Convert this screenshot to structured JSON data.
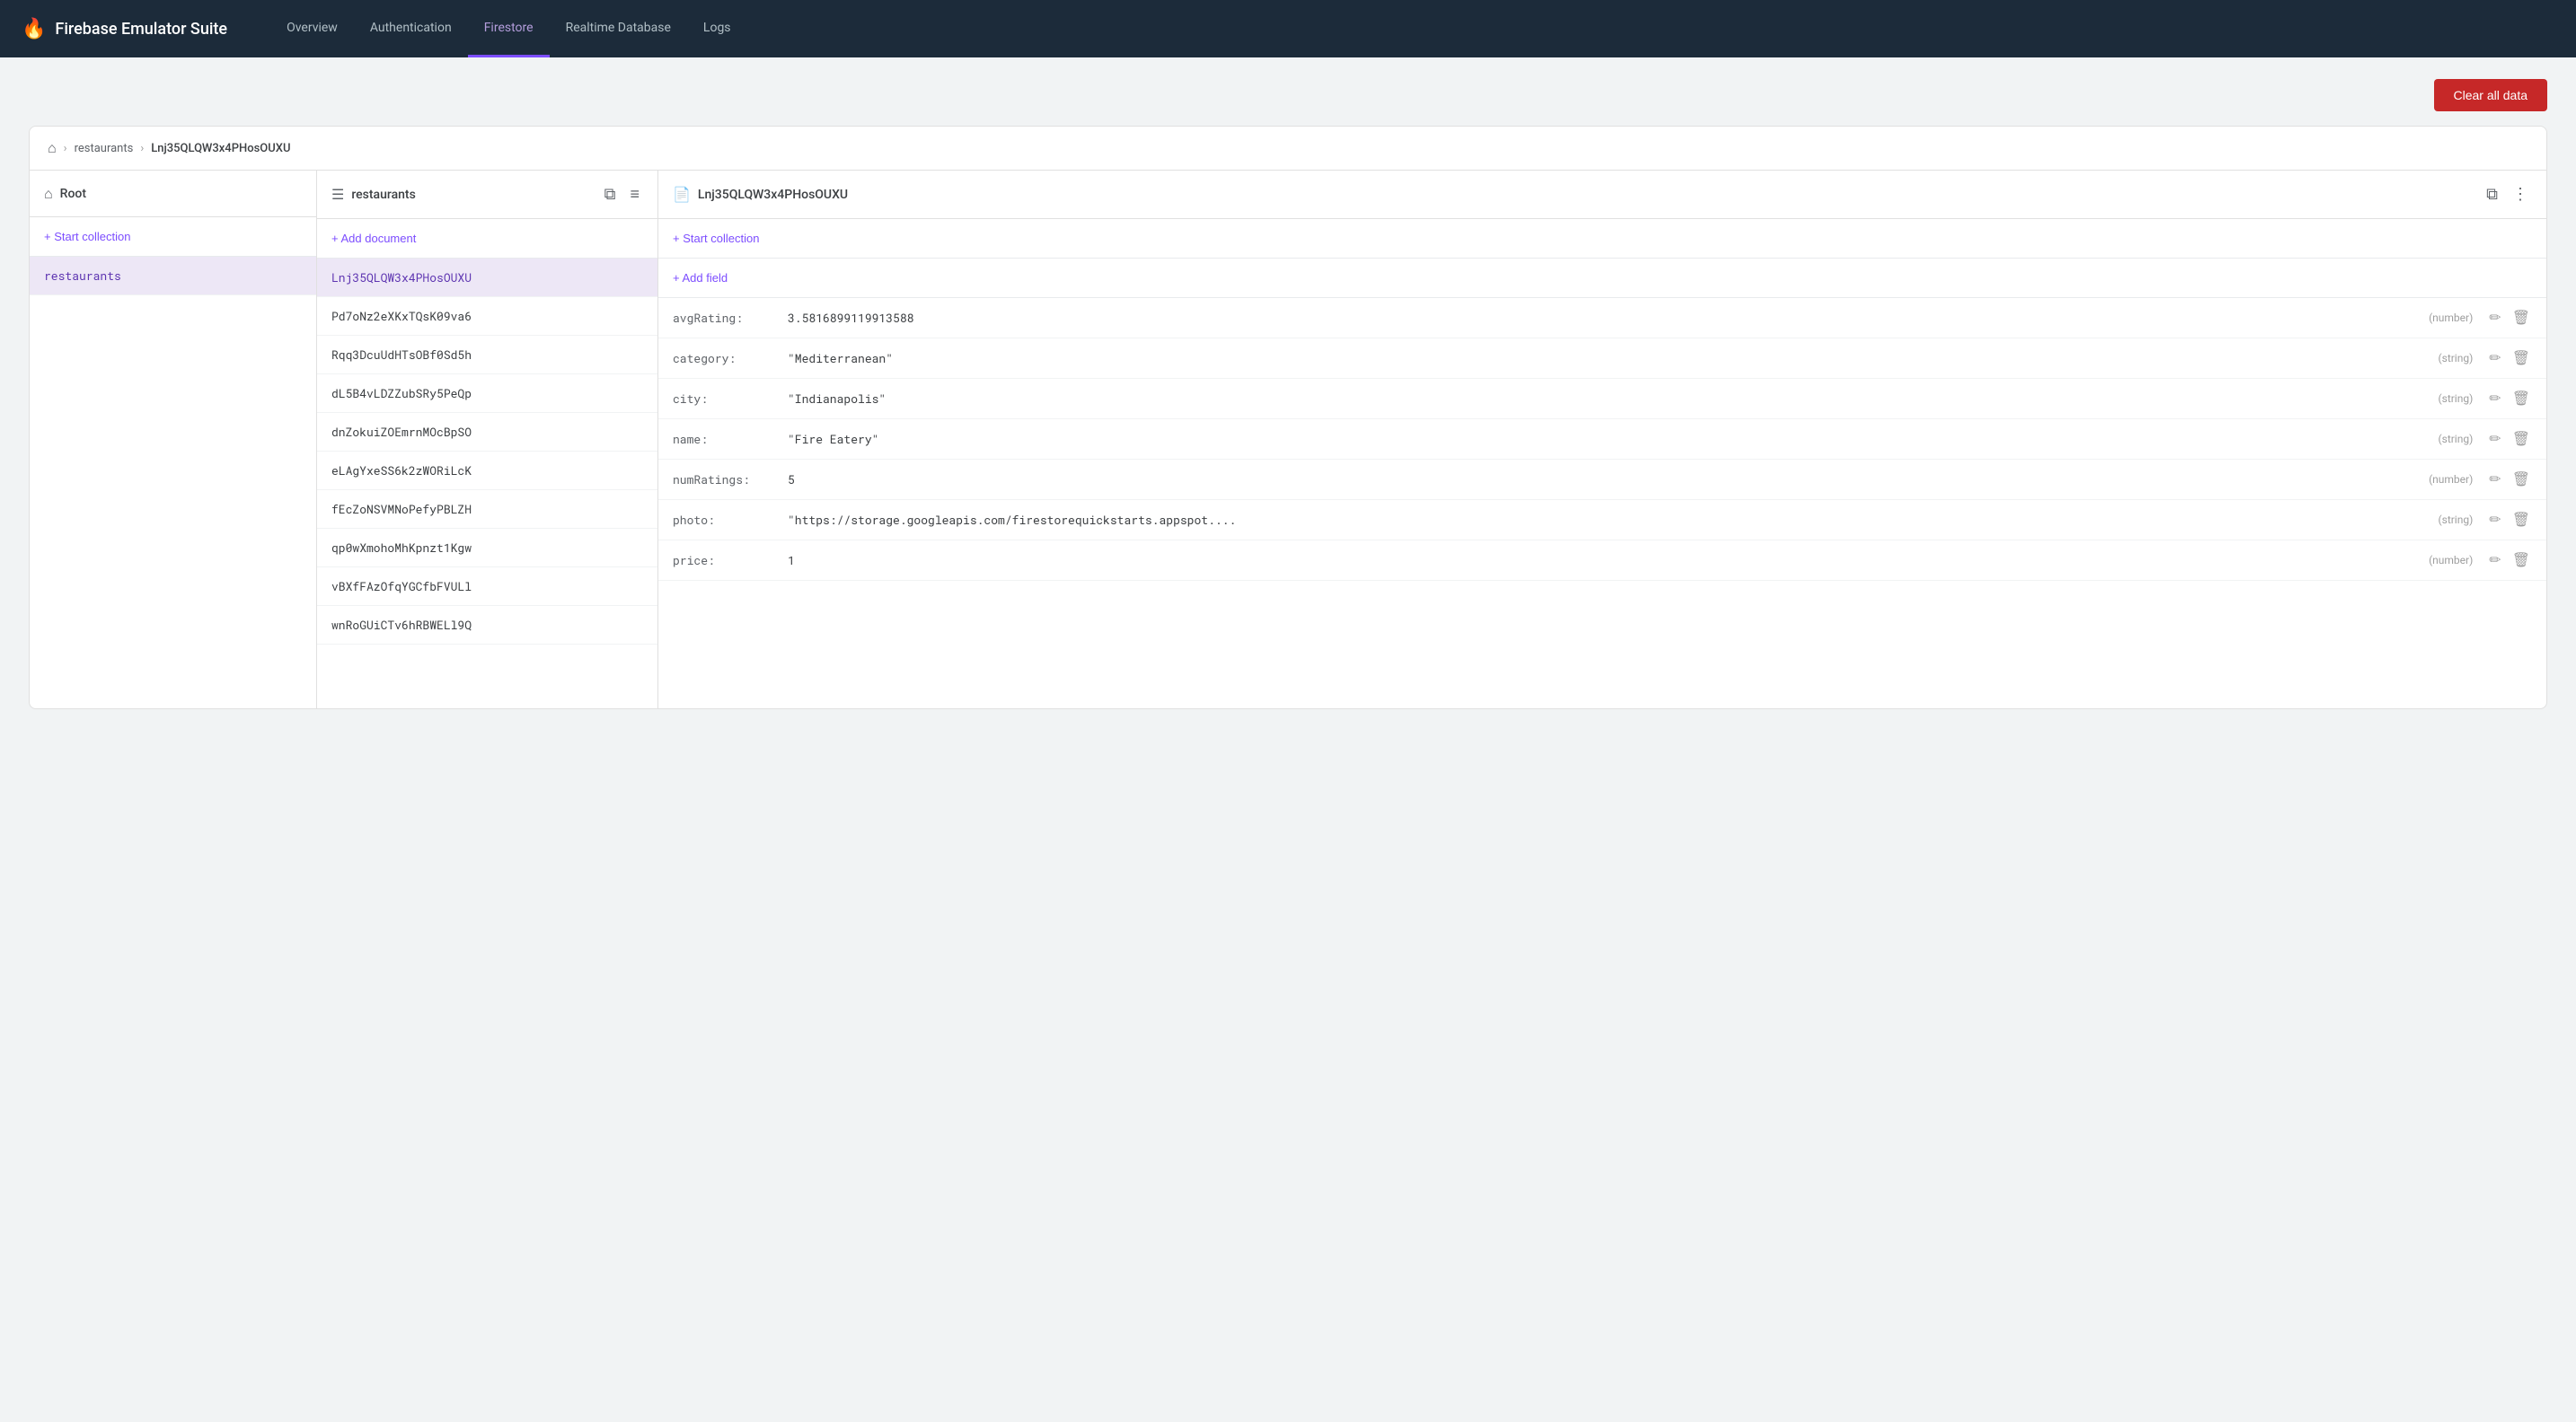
{
  "app": {
    "title": "Firebase Emulator Suite",
    "flame_icon": "🔥"
  },
  "nav": {
    "tabs": [
      {
        "id": "overview",
        "label": "Overview",
        "active": false
      },
      {
        "id": "authentication",
        "label": "Authentication",
        "active": false
      },
      {
        "id": "firestore",
        "label": "Firestore",
        "active": true
      },
      {
        "id": "realtime-database",
        "label": "Realtime Database",
        "active": false
      },
      {
        "id": "logs",
        "label": "Logs",
        "active": false
      }
    ]
  },
  "toolbar": {
    "clear_all_label": "Clear all data"
  },
  "breadcrumb": {
    "home_icon": "⌂",
    "separator": "›",
    "items": [
      {
        "id": "restaurants",
        "label": "restaurants"
      },
      {
        "id": "doc-id",
        "label": "Lnj35QLQW3x4PHosOUXU"
      }
    ]
  },
  "panels": {
    "root": {
      "icon": "⌂",
      "title": "Root",
      "start_collection_label": "+ Start collection",
      "items": [
        {
          "id": "restaurants",
          "label": "restaurants",
          "selected": true
        }
      ]
    },
    "collection": {
      "icon": "☰",
      "title": "restaurants",
      "add_document_label": "+ Add document",
      "items": [
        {
          "id": "Lnj35QLQW3x4PHosOUXU",
          "label": "Lnj35QLQW3x4PHosOUXU",
          "selected": true
        },
        {
          "id": "Pd7oNz2eXKxTQsK09va6",
          "label": "Pd7oNz2eXKxTQsK09va6",
          "selected": false
        },
        {
          "id": "Rqq3DcuUdHTsOBf0Sd5h",
          "label": "Rqq3DcuUdHTsOBf0Sd5h",
          "selected": false
        },
        {
          "id": "dL5B4vLDZZubSRy5PeQp",
          "label": "dL5B4vLDZZubSRy5PeQp",
          "selected": false
        },
        {
          "id": "dnZokuiZOEmrnMOcBpSO",
          "label": "dnZokuiZOEmrnMOcBpSO",
          "selected": false
        },
        {
          "id": "eLAgYxeSS6k2zWORiLcK",
          "label": "eLAgYxeSS6k2zWORiLcK",
          "selected": false
        },
        {
          "id": "fEcZoNSVMNoPefyPBLZH",
          "label": "fEcZoNSVMNoPefyPBLZH",
          "selected": false
        },
        {
          "id": "qp0wXmohoMhKpnzt1Kgw",
          "label": "qp0wXmohoMhKpnzt1Kgw",
          "selected": false
        },
        {
          "id": "vBXfFAzOfqYGCfbFVULl",
          "label": "vBXfFAzOfqYGCfbFVULl",
          "selected": false
        },
        {
          "id": "wnRoGUiCTv6hRBWELl9Q",
          "label": "wnRoGUiCTv6hRBWELl9Q",
          "selected": false
        }
      ]
    },
    "document": {
      "icon": "📄",
      "title": "Lnj35QLQW3x4PHosOUXU",
      "start_collection_label": "+ Start collection",
      "add_field_label": "+ Add field",
      "fields": [
        {
          "key": "avgRating:",
          "value": "3.5816899119913588",
          "type": "(number)"
        },
        {
          "key": "category:",
          "value": "\"Mediterranean\"",
          "type": "(string)"
        },
        {
          "key": "city:",
          "value": "\"Indianapolis\"",
          "type": "(string)"
        },
        {
          "key": "name:",
          "value": "\"Fire Eatery\"",
          "type": "(string)"
        },
        {
          "key": "numRatings:",
          "value": "5",
          "type": "(number)"
        },
        {
          "key": "photo:",
          "value": "\"https://storage.googleapis.com/firestorequickstarts.appspot....",
          "type": "(string)"
        },
        {
          "key": "price:",
          "value": "1",
          "type": "(number)"
        }
      ],
      "edit_icon": "✏",
      "delete_icon": "🗑"
    }
  }
}
